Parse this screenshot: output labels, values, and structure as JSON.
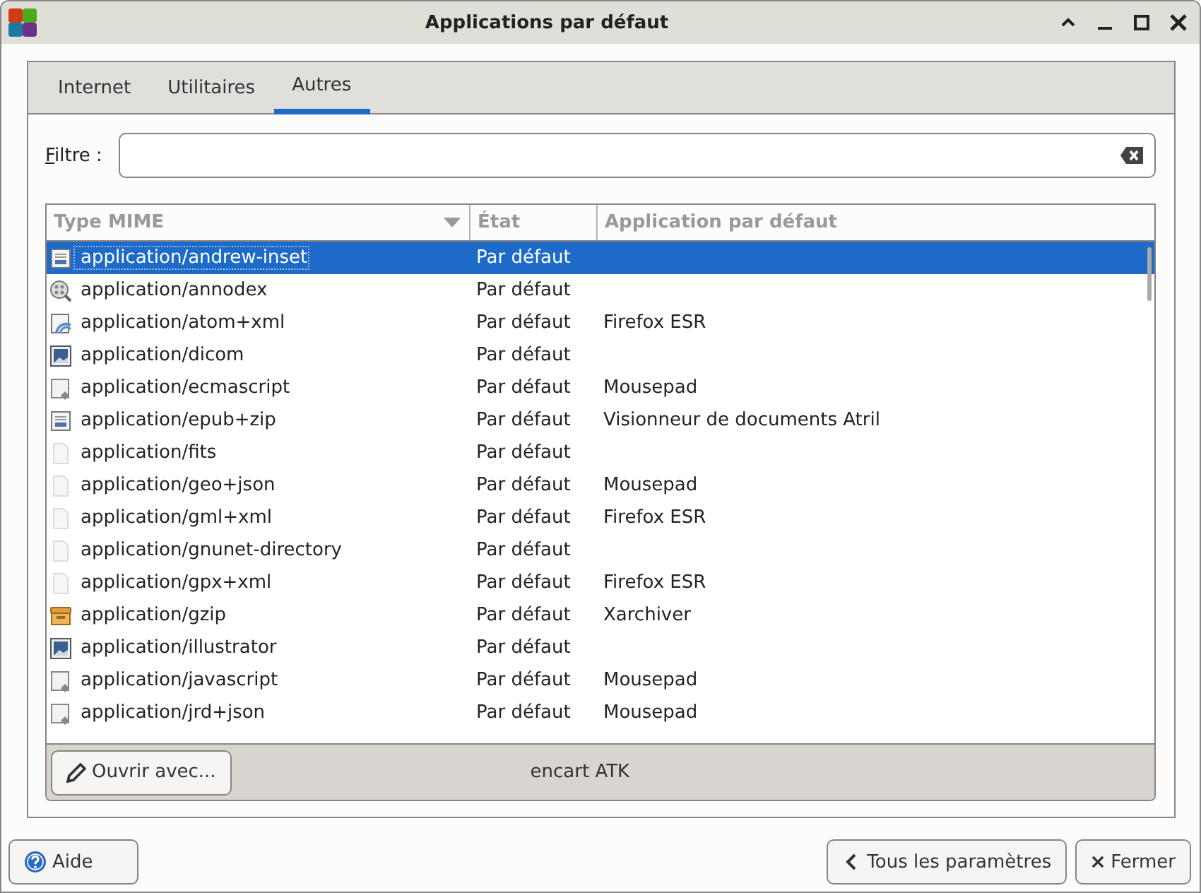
{
  "window": {
    "title": "Applications par défaut"
  },
  "tabs": [
    {
      "label": "Internet",
      "selected": false
    },
    {
      "label": "Utilitaires",
      "selected": false
    },
    {
      "label": "Autres",
      "selected": true
    }
  ],
  "filter": {
    "label": "Filtre :"
  },
  "table": {
    "columns": [
      "Type MIME",
      "État",
      "Application par défaut"
    ],
    "rows": [
      {
        "kind": "doc",
        "mime": "application/andrew-inset",
        "state": "Par défaut",
        "app": "",
        "selected": true
      },
      {
        "kind": "media",
        "mime": "application/annodex",
        "state": "Par défaut",
        "app": "",
        "selected": false
      },
      {
        "kind": "feed",
        "mime": "application/atom+xml",
        "state": "Par défaut",
        "app": "Firefox ESR",
        "selected": false
      },
      {
        "kind": "image",
        "mime": "application/dicom",
        "state": "Par défaut",
        "app": "",
        "selected": false
      },
      {
        "kind": "script",
        "mime": "application/ecmascript",
        "state": "Par défaut",
        "app": "Mousepad",
        "selected": false
      },
      {
        "kind": "doc",
        "mime": "application/epub+zip",
        "state": "Par défaut",
        "app": "Visionneur de documents Atril",
        "selected": false
      },
      {
        "kind": "blank",
        "mime": "application/fits",
        "state": "Par défaut",
        "app": "",
        "selected": false
      },
      {
        "kind": "blank",
        "mime": "application/geo+json",
        "state": "Par défaut",
        "app": "Mousepad",
        "selected": false
      },
      {
        "kind": "blank",
        "mime": "application/gml+xml",
        "state": "Par défaut",
        "app": "Firefox ESR",
        "selected": false
      },
      {
        "kind": "blank",
        "mime": "application/gnunet-directory",
        "state": "Par défaut",
        "app": "",
        "selected": false
      },
      {
        "kind": "blank",
        "mime": "application/gpx+xml",
        "state": "Par défaut",
        "app": "Firefox ESR",
        "selected": false
      },
      {
        "kind": "archive",
        "mime": "application/gzip",
        "state": "Par défaut",
        "app": "Xarchiver",
        "selected": false
      },
      {
        "kind": "image",
        "mime": "application/illustrator",
        "state": "Par défaut",
        "app": "",
        "selected": false
      },
      {
        "kind": "script",
        "mime": "application/javascript",
        "state": "Par défaut",
        "app": "Mousepad",
        "selected": false
      },
      {
        "kind": "script",
        "mime": "application/jrd+json",
        "state": "Par défaut",
        "app": "Mousepad",
        "selected": false
      }
    ]
  },
  "open_with_button": "Ouvrir avec...",
  "status": "encart ATK",
  "buttons": {
    "help": "Aide",
    "all_settings": "Tous les paramètres",
    "close": "Fermer"
  }
}
